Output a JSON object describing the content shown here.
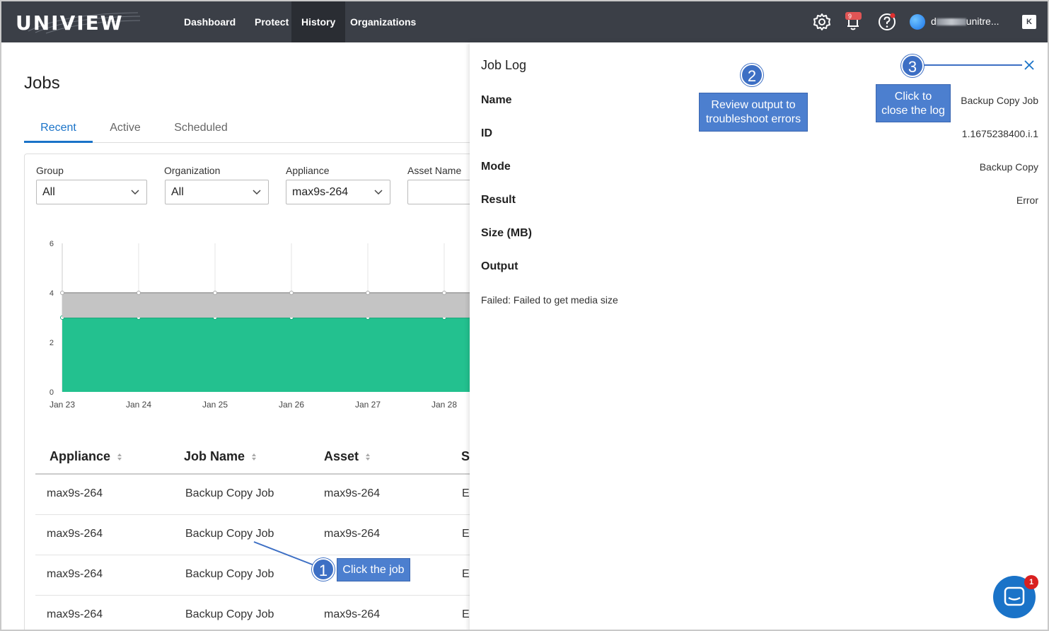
{
  "brand": {
    "logo_text": "UNIVIEW"
  },
  "nav": {
    "items": [
      {
        "label": "Dashboard"
      },
      {
        "label": "Protect"
      },
      {
        "label": "History"
      },
      {
        "label": "Organizations"
      }
    ],
    "active": "History",
    "notification_count": "9",
    "user_name_start": "d",
    "user_name_end": "unitre...",
    "k_badge": "K"
  },
  "page": {
    "title": "Jobs",
    "tabs": [
      {
        "label": "Recent"
      },
      {
        "label": "Active"
      },
      {
        "label": "Scheduled"
      }
    ],
    "active_tab": "Recent"
  },
  "filters": {
    "group": {
      "label": "Group",
      "value": "All"
    },
    "organization": {
      "label": "Organization",
      "value": "All"
    },
    "appliance": {
      "label": "Appliance",
      "value": "max9s-264"
    },
    "asset_name": {
      "label": "Asset Name",
      "value": ""
    }
  },
  "chart_data": {
    "type": "area",
    "x": [
      "Jan 23",
      "Jan 24",
      "Jan 25",
      "Jan 26",
      "Jan 27",
      "Jan 28"
    ],
    "series": [
      {
        "values": [
          3,
          3,
          3,
          3,
          3,
          3
        ],
        "color": "#23c18f"
      },
      {
        "values": [
          1,
          1,
          1,
          1,
          1,
          1
        ],
        "color": "#c4c4c4"
      }
    ],
    "stacked": true,
    "yticks": [
      0,
      2,
      4,
      6
    ],
    "ylim": [
      0,
      6
    ],
    "grid": true
  },
  "table": {
    "columns": [
      "Appliance",
      "Job Name",
      "Asset",
      "St"
    ],
    "rows": [
      [
        "max9s-264",
        "Backup Copy Job",
        "max9s-264",
        "E"
      ],
      [
        "max9s-264",
        "Backup Copy Job",
        "max9s-264",
        "E"
      ],
      [
        "max9s-264",
        "Backup Copy Job",
        "",
        "E"
      ],
      [
        "max9s-264",
        "Backup Copy Job",
        "max9s-264",
        "E"
      ]
    ]
  },
  "job_log": {
    "title": "Job Log",
    "fields": [
      {
        "label": "Name",
        "value": "Backup Copy Job"
      },
      {
        "label": "ID",
        "value": "1.1675238400.i.1"
      },
      {
        "label": "Mode",
        "value": "Backup Copy"
      },
      {
        "label": "Result",
        "value": "Error"
      },
      {
        "label": "Size (MB)",
        "value": ""
      },
      {
        "label": "Output",
        "value": ""
      }
    ],
    "output_text": "Failed: Failed to get media size"
  },
  "annotations": [
    {
      "number": "1",
      "text": "Click the job"
    },
    {
      "number": "2",
      "text_line1": "Review output to",
      "text_line2": "troubleshoot errors"
    },
    {
      "number": "3",
      "text_line1": "Click to",
      "text_line2": "close the log"
    }
  ],
  "chat": {
    "badge": "1"
  },
  "colors": {
    "topbar": "#3b3f47",
    "accent": "#1a73c8",
    "chart_green": "#23c18f",
    "chart_gray": "#c4c4c4",
    "callout": "#4c7fcf"
  }
}
